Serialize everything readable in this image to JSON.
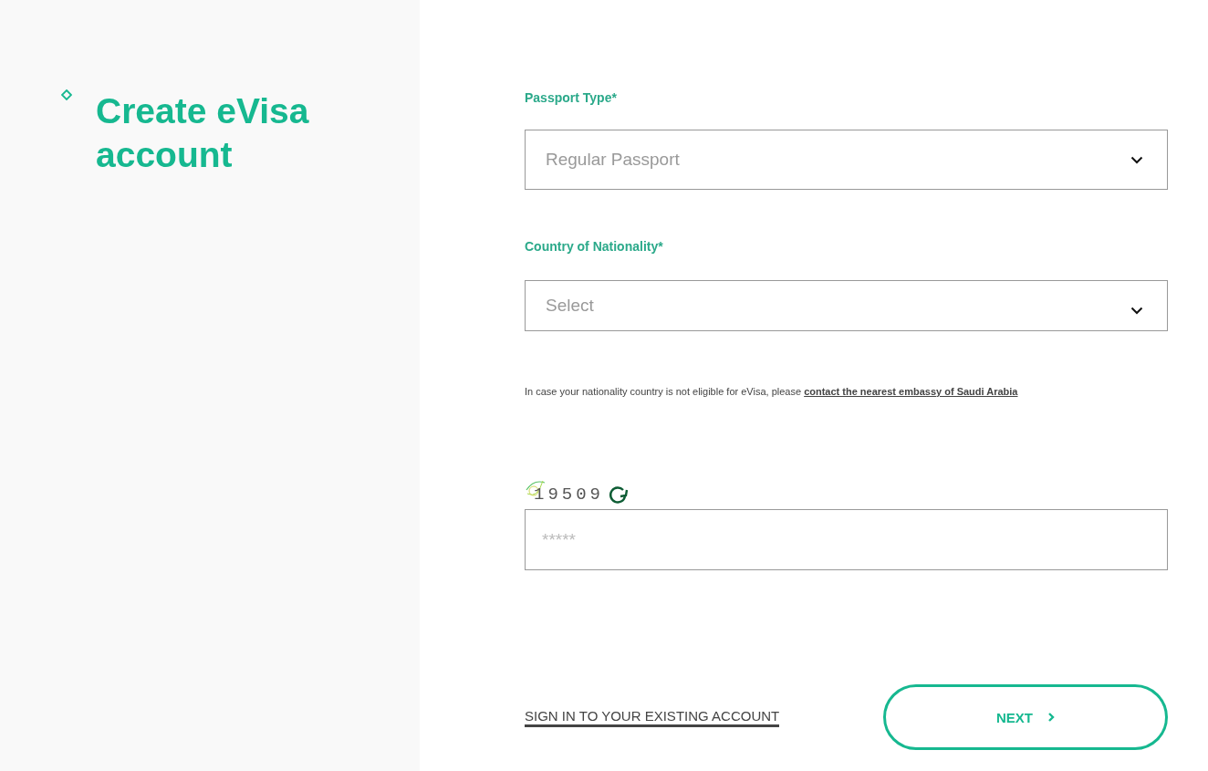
{
  "sidebar": {
    "title": "Create eVisa account"
  },
  "form": {
    "fields": [
      {
        "kind": "select",
        "label": "Passport Type*",
        "value": "Regular Passport"
      },
      {
        "kind": "select",
        "label": "Country of Nationality*",
        "value": "Select"
      }
    ],
    "notice": {
      "text": "In case your nationality country is not eligible for eVisa, please",
      "link": "contact the nearest embassy of Saudi Arabia"
    },
    "captcha": {
      "code": "19509",
      "placeholder": "*****"
    },
    "sign_in_link": "SIGN IN TO YOUR EXISTING ACCOUNT",
    "next_button": "NEXT"
  }
}
